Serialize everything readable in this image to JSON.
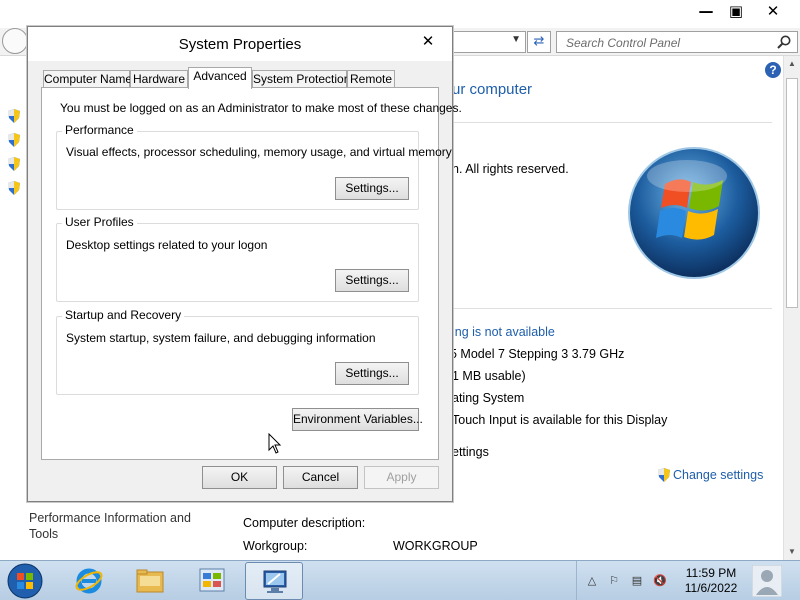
{
  "background_window": {
    "search_placeholder": "Search Control Panel",
    "heading_fragment": "ur computer",
    "copyright_fragment": "n.  All rights reserved.",
    "activation_fragment": "ing is not available",
    "processor_fragment": "5 Model 7 Stepping 3   3.79 GHz",
    "ram_fragment": "1 MB usable)",
    "system_type_fragment": "ating System",
    "pen_touch_fragment": "Touch Input is available for this Display",
    "settings_fragment": "ettings",
    "change_settings": "Change settings",
    "computer_desc_label": "Computer description:",
    "workgroup_label": "Workgroup:",
    "workgroup_value": "WORKGROUP",
    "see_also_link": "Performance Information and Tools",
    "window_controls": {
      "minimize": "—",
      "maximize": "▣",
      "close": "✕"
    },
    "colors": {
      "link": "#1e5eab"
    }
  },
  "dialog": {
    "title": "System Properties",
    "close": "✕",
    "tabs": [
      {
        "label": "Computer Name",
        "active": false
      },
      {
        "label": "Hardware",
        "active": false
      },
      {
        "label": "Advanced",
        "active": true
      },
      {
        "label": "System Protection",
        "active": false
      },
      {
        "label": "Remote",
        "active": false
      }
    ],
    "admin_note": "You must be logged on as an Administrator to make most of these changes.",
    "groups": [
      {
        "title": "Performance",
        "description": "Visual effects, processor scheduling, memory usage, and virtual memory",
        "button": "Settings..."
      },
      {
        "title": "User Profiles",
        "description": "Desktop settings related to your logon",
        "button": "Settings..."
      },
      {
        "title": "Startup and Recovery",
        "description": "System startup, system failure, and debugging information",
        "button": "Settings..."
      }
    ],
    "env_button": "Environment Variables...",
    "ok_button": "OK",
    "cancel_button": "Cancel",
    "apply_button": "Apply"
  },
  "taskbar": {
    "items": [
      "internet-explorer",
      "file-explorer",
      "control-panel",
      "system-properties"
    ],
    "clock_time": "11:59 PM",
    "clock_date": "11/6/2022",
    "tray_icons": [
      "show-hidden-icon",
      "action-center-flag-icon",
      "network-icon",
      "volume-muted-icon"
    ]
  }
}
